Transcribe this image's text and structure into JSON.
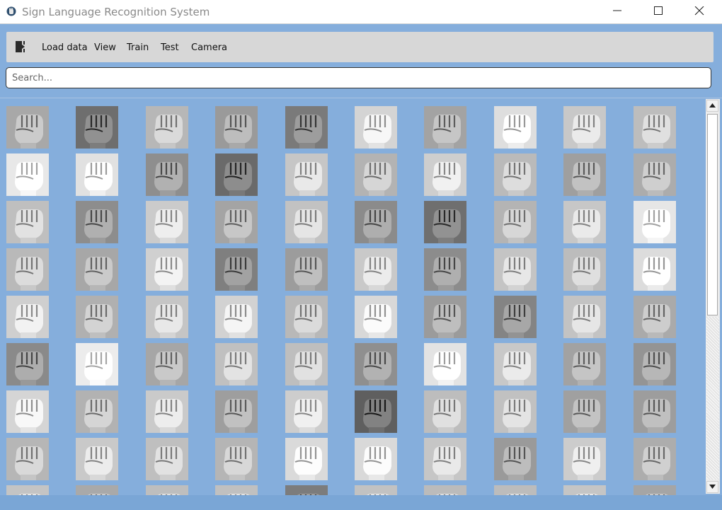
{
  "window": {
    "title": "Sign Language Recognition System",
    "icon": "app-hand-icon"
  },
  "toolbar": {
    "exit_icon": "exit-door-icon",
    "items": [
      "Load data",
      "View",
      "Train",
      "Test",
      "Camera"
    ]
  },
  "search": {
    "placeholder": "Search..."
  },
  "colors": {
    "background": "#85aedc",
    "toolbar": "#d7d7d7"
  },
  "gallery": {
    "columns": 10,
    "rows_visible": 9,
    "tones": [
      [
        "#a8a8a8",
        "#6e6e6e",
        "#b7b7b7",
        "#9a9a9a",
        "#7a7a7a",
        "#d4d4d4",
        "#a3a3a3",
        "#dedede",
        "#c8c8c8",
        "#bdbdbd"
      ],
      [
        "#e8e8e8",
        "#e1e1e1",
        "#8e8e8e",
        "#6a6a6a",
        "#c6c6c6",
        "#b3b3b3",
        "#cecece",
        "#bababa",
        "#9f9f9f",
        "#acacac"
      ],
      [
        "#bfbfbf",
        "#8d8d8d",
        "#cbcbcb",
        "#a4a4a4",
        "#c2c2c2",
        "#8b8b8b",
        "#6f6f6f",
        "#b4b4b4",
        "#c7c7c7",
        "#e6e6e6"
      ],
      [
        "#b9b9b9",
        "#a7a7a7",
        "#d0d0d0",
        "#7f7f7f",
        "#9c9c9c",
        "#c9c9c9",
        "#8c8c8c",
        "#c4c4c4",
        "#bcbcbc",
        "#dcdcdc"
      ],
      [
        "#cfcfcf",
        "#b0b0b0",
        "#c5c5c5",
        "#d2d2d2",
        "#b8b8b8",
        "#d8d8d8",
        "#9b9b9b",
        "#848484",
        "#c3c3c3",
        "#aaaaaa"
      ],
      [
        "#8a8a8a",
        "#ececec",
        "#a6a6a6",
        "#c0c0c0",
        "#bebebe",
        "#8f8f8f",
        "#e3e3e3",
        "#c8c8c8",
        "#a2a2a2",
        "#949494"
      ],
      [
        "#d5d5d5",
        "#b2b2b2",
        "#cacaca",
        "#9e9e9e",
        "#cdcdcd",
        "#5f5f5f",
        "#bdbdbd",
        "#c1c1c1",
        "#a0a0a0",
        "#9d9d9d"
      ],
      [
        "#b6b6b6",
        "#c9c9c9",
        "#bfbfbf",
        "#b5b5b5",
        "#dadada",
        "#d9d9d9",
        "#c6c6c6",
        "#9a9a9a",
        "#cccccc",
        "#adadad"
      ],
      [
        "#c4c4c4",
        "#a9a9a9",
        "#bebebe",
        "#c0c0c0",
        "#7c7c7c",
        "#c2c2c2",
        "#bbbbbb",
        "#bcbcbc",
        "#c5c5c5",
        "#a5a5a5"
      ]
    ]
  }
}
